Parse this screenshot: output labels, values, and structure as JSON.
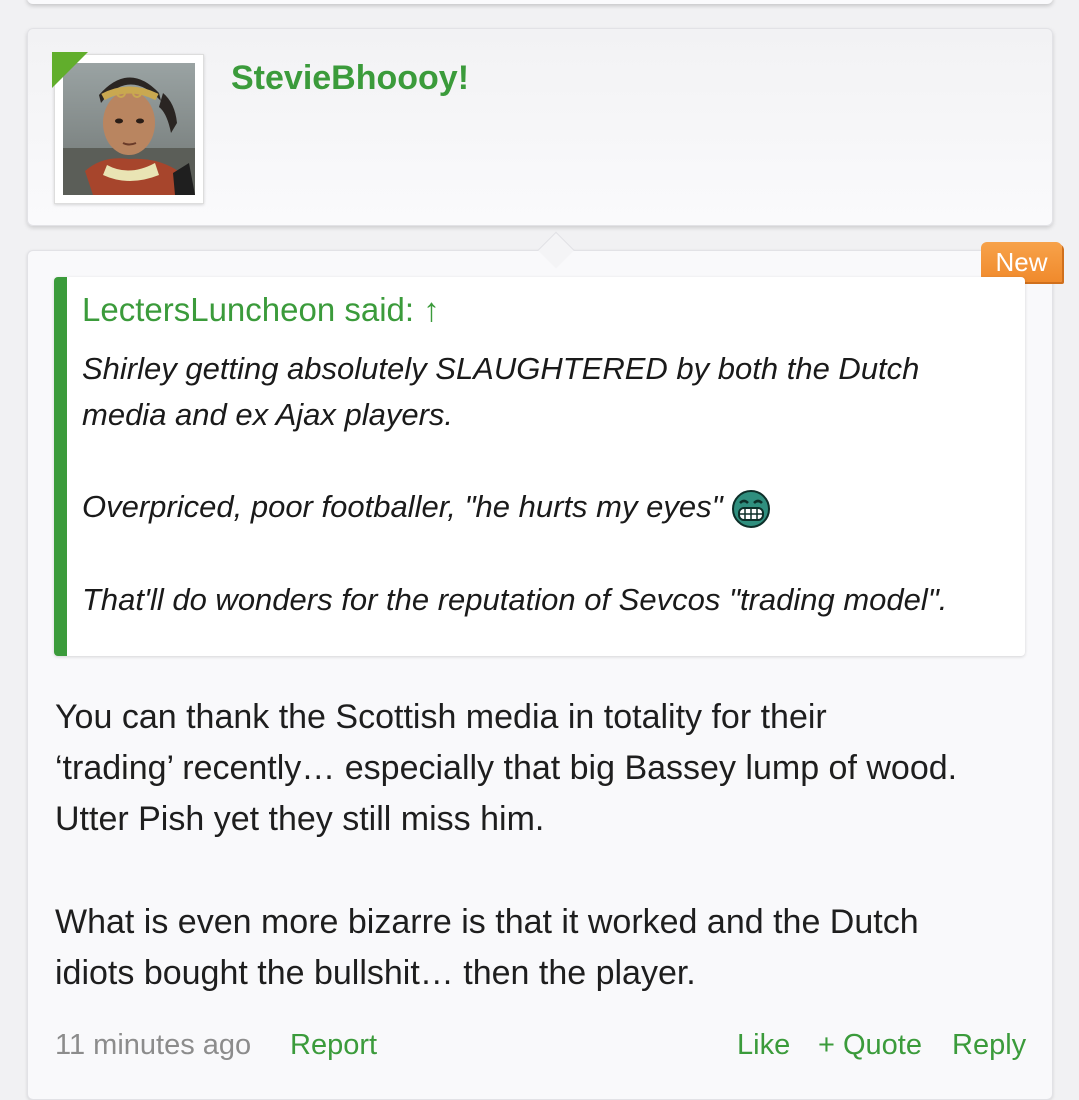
{
  "post": {
    "username": "StevieBhoooy!",
    "badge": "New",
    "quote": {
      "author": "LectersLuncheon said: ↑",
      "lines": [
        "Shirley getting absolutely SLAUGHTERED by both the Dutch",
        "media and ex Ajax players.",
        "Overpriced, poor footballer, \"he hurts my eyes\"",
        "That'll do wonders for the reputation of Sevcos \"trading model\"."
      ],
      "emoji": "grin-icon"
    },
    "body": [
      "You can thank the Scottish media in totality for their",
      "‘trading’ recently… especially that big Bassey lump of wood.",
      "Utter Pish yet they still miss him.",
      "What is even more bizarre is that it worked and the Dutch",
      "idiots bought the bullshit… then the player."
    ],
    "footer": {
      "time": "11 minutes ago",
      "report": "Report",
      "like": "Like",
      "quote": "+ Quote",
      "reply": "Reply"
    }
  },
  "colors": {
    "accent": "#3b9b3b",
    "badge": "#f08a2c",
    "online": "#61ae2c"
  }
}
